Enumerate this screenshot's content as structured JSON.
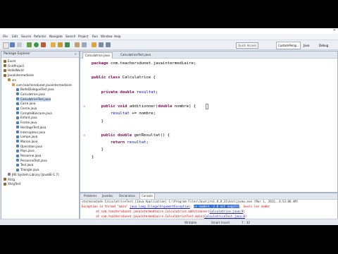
{
  "window": {
    "close_glyph": "×"
  },
  "menu": [
    "File",
    "Edit",
    "Source",
    "Refactor",
    "Navigate",
    "Search",
    "Project",
    "Run",
    "Window",
    "Help"
  ],
  "toolbar": {
    "quick_access": "Quick Access",
    "perspectives": [
      "CustomPersp..",
      "Java",
      "Debug"
    ]
  },
  "package_explorer": {
    "tab_label": "Package Explorer",
    "tab_close": "×",
    "items": [
      {
        "label": "Excel",
        "icon": "project-icon"
      },
      {
        "label": "FirstProject",
        "icon": "project-icon"
      },
      {
        "label": "HelloWorld",
        "icon": "project-icon"
      },
      {
        "label": "JavaIntermediaire",
        "icon": "project-icon"
      },
      {
        "label": "src",
        "icon": "source-folder-icon"
      },
      {
        "label": "com.teachersdunet.javaintermediaire",
        "icon": "package-icon"
      },
      {
        "label": "BoiteDialogueTest.java",
        "icon": "java-file-icon"
      },
      {
        "label": "Calculatrice.java",
        "icon": "java-file-icon"
      },
      {
        "label": "CalculatriceTest.java",
        "icon": "java-file-icon"
      },
      {
        "label": "Carre.java",
        "icon": "java-file-icon"
      },
      {
        "label": "Cercle.java",
        "icon": "java-file-icon"
      },
      {
        "label": "CompteBancaire.java",
        "icon": "java-file-icon"
      },
      {
        "label": "Enfant.java",
        "icon": "java-file-icon"
      },
      {
        "label": "Forme.java",
        "icon": "java-file-icon"
      },
      {
        "label": "HeritageTest.java",
        "icon": "java-file-icon"
      },
      {
        "label": "Interrupteur.java",
        "icon": "java-file-icon"
      },
      {
        "label": "Lampe.java",
        "icon": "java-file-icon"
      },
      {
        "label": "Marion.java",
        "icon": "java-file-icon"
      },
      {
        "label": "Operation.java",
        "icon": "java-file-icon"
      },
      {
        "label": "Pays.java",
        "icon": "java-file-icon"
      },
      {
        "label": "Personne.java",
        "icon": "java-file-icon"
      },
      {
        "label": "PersonneTest.java",
        "icon": "java-file-icon"
      },
      {
        "label": "Test.java",
        "icon": "java-file-icon"
      },
      {
        "label": "Triangle.java",
        "icon": "java-file-icon"
      },
      {
        "label": "JRE System Library [JavaSE-1.7]",
        "icon": "library-icon"
      },
      {
        "label": "Xtrig",
        "icon": "project-icon"
      },
      {
        "label": "XtrigTest",
        "icon": "project-icon"
      }
    ]
  },
  "editor": {
    "tabs": [
      "Calculatrice.java",
      "CalculatriceTest.java"
    ],
    "active_tab": 0,
    "lines": [
      [
        {
          "t": "package ",
          "c": "kw"
        },
        {
          "t": "com.teachersdunet.javaintermediaire;",
          "c": ""
        }
      ],
      [],
      [
        {
          "t": "public class ",
          "c": "kw"
        },
        {
          "t": "Calculatrice {",
          "c": ""
        }
      ],
      [],
      [
        {
          "t": "    private double ",
          "c": "kw"
        },
        {
          "t": "resultat",
          "c": "fld"
        },
        {
          "t": ";",
          "c": ""
        }
      ],
      [],
      [
        {
          "t": "    public void ",
          "c": "kw"
        },
        {
          "t": "additionner(",
          "c": ""
        },
        {
          "t": "double ",
          "c": "kw"
        },
        {
          "t": "nombre) {",
          "c": ""
        }
      ],
      [
        {
          "t": "        ",
          "c": ""
        },
        {
          "t": "resultat",
          "c": "fld"
        },
        {
          "t": " += nombre;",
          "c": ""
        }
      ],
      [
        {
          "t": "    }",
          "c": ""
        }
      ],
      [],
      [
        {
          "t": "    public double ",
          "c": "kw"
        },
        {
          "t": "getResultat() {",
          "c": ""
        }
      ],
      [
        {
          "t": "        return ",
          "c": "kw"
        },
        {
          "t": "resultat",
          "c": "fld"
        },
        {
          "t": ";",
          "c": ""
        }
      ],
      [
        {
          "t": "    }",
          "c": ""
        }
      ],
      [
        {
          "t": "}",
          "c": ""
        }
      ]
    ]
  },
  "console": {
    "tabs": [
      "Problems",
      "Javadoc",
      "Declaration",
      "Console"
    ],
    "active_tab": 3,
    "header": "<terminated> CalculatriceTest [Java Application] C:\\Program Files\\Java\\jre1.8.0_31\\bin\\javaw.exe (Mar 1, 2015, 4:53:08 AM)",
    "lines": [
      [
        {
          "t": "Exception in thread \"main\" ",
          "c": "err"
        },
        {
          "t": "java.lang.IllegalArgumentException",
          "c": "lnk"
        },
        {
          "t": ": ",
          "c": "err"
        },
        {
          "t": "Le nombre -2.0 est negatif",
          "c": "hl"
        },
        {
          "t": ". Seuls les nombr",
          "c": "err"
        }
      ],
      [
        {
          "t": "        at com.teachersdunet.javaintermediaire.Calculatrice.additionner(",
          "c": "err"
        },
        {
          "t": "Calculatrice.java:9",
          "c": "lnk"
        },
        {
          "t": ")",
          "c": "err"
        }
      ],
      [
        {
          "t": "        at com.teachersdunet.javaintermediaire.CalculatriceTest.main(",
          "c": "err"
        },
        {
          "t": "CalculatriceTest.java:8",
          "c": "lnk"
        },
        {
          "t": ")",
          "c": "err"
        }
      ]
    ]
  },
  "status": {
    "writable": "Writable",
    "insert_mode": "Smart Insert",
    "position": "7 : 32"
  },
  "colors": {
    "keyword": "#7f0055",
    "field": "#0000c0",
    "error": "#d00000",
    "link": "#1a1ad0",
    "selection": "#3a6fd8"
  }
}
